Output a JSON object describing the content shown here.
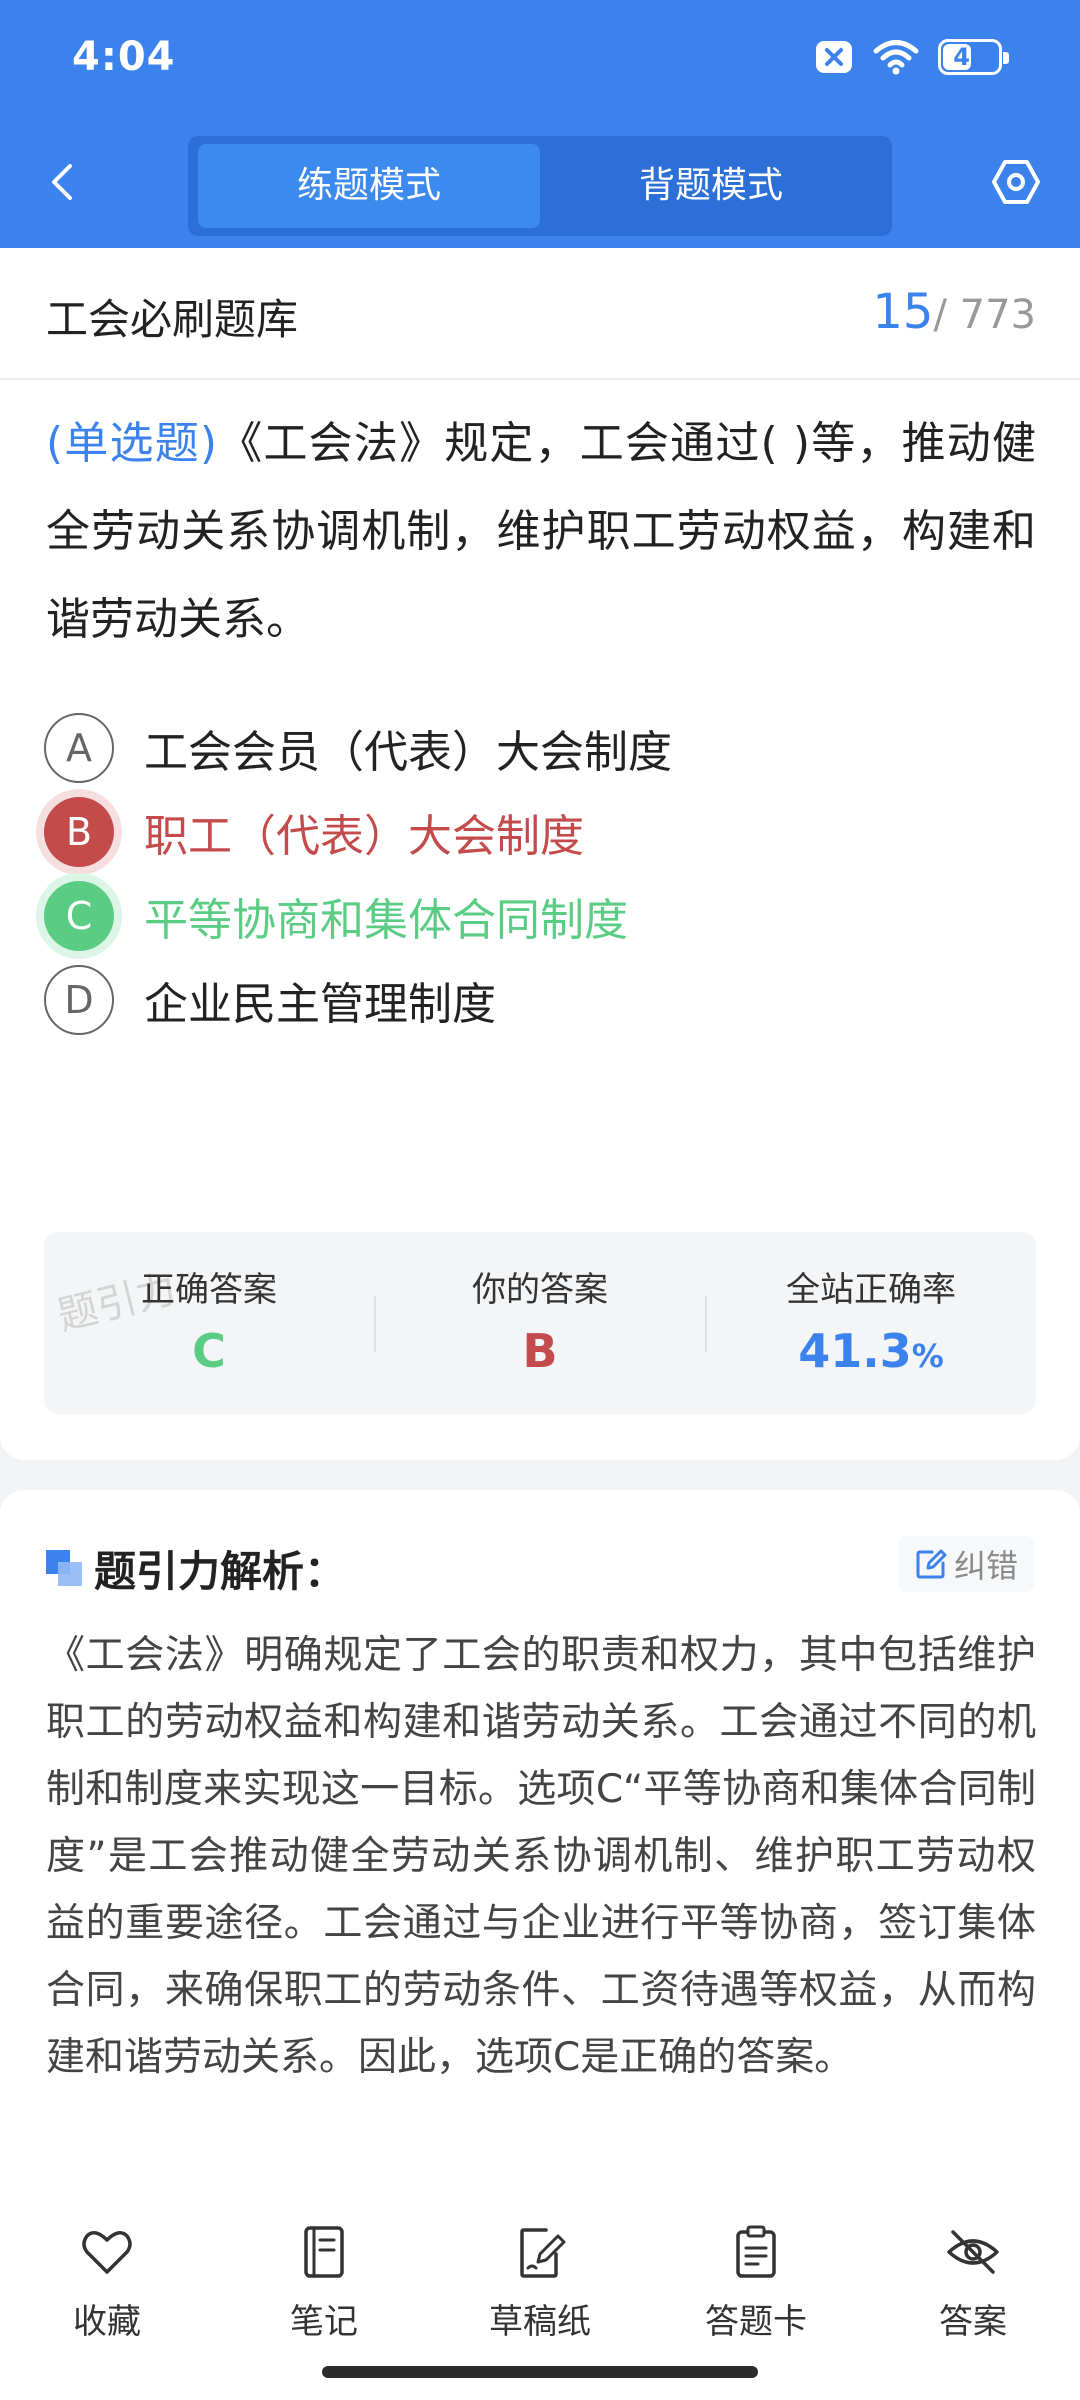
{
  "status_bar": {
    "time": "4:04",
    "battery": "45"
  },
  "header": {
    "tabs": [
      {
        "label": "练题模式"
      },
      {
        "label": "背题模式"
      }
    ]
  },
  "question_bank": {
    "title": "工会必刷题库",
    "current": "15",
    "total": "/ 773"
  },
  "question": {
    "type": "(单选题)",
    "text": "《工会法》规定，工会通过( )等，推动健全劳动关系协调机制，维护职工劳动权益，构建和谐劳动关系。"
  },
  "options": [
    {
      "letter": "A",
      "text": "工会会员（代表）大会制度",
      "state": "normal"
    },
    {
      "letter": "B",
      "text": "职工（代表）大会制度",
      "state": "wrong"
    },
    {
      "letter": "C",
      "text": "平等协商和集体合同制度",
      "state": "correct"
    },
    {
      "letter": "D",
      "text": "企业民主管理制度",
      "state": "normal"
    }
  ],
  "stats": {
    "correct_label": "正确答案",
    "correct_value": "C",
    "yours_label": "你的答案",
    "yours_value": "B",
    "rate_label": "全站正确率",
    "rate_value": "41.3",
    "rate_unit": "%",
    "watermark": "题引力"
  },
  "analysis": {
    "title": "题引力解析：",
    "fix_label": "纠错",
    "text": "《工会法》明确规定了工会的职责和权力，其中包括维护职工的劳动权益和构建和谐劳动关系。工会通过不同的机制和制度来实现这一目标。选项C“平等协商和集体合同制度”是工会推动健全劳动关系协调机制、维护职工劳动权益的重要途径。工会通过与企业进行平等协商，签订集体合同，来确保职工的劳动条件、工资待遇等权益，从而构建和谐劳动关系。因此，选项C是正确的答案。"
  },
  "bottom_bar": [
    {
      "label": "收藏",
      "icon": "heart-icon"
    },
    {
      "label": "笔记",
      "icon": "notebook-icon"
    },
    {
      "label": "草稿纸",
      "icon": "draft-paper-icon"
    },
    {
      "label": "答题卡",
      "icon": "answer-card-icon"
    },
    {
      "label": "答案",
      "icon": "eye-off-icon"
    }
  ],
  "colors": {
    "primary": "#3b82ec",
    "correct": "#5bcc84",
    "wrong": "#c44b4b"
  }
}
